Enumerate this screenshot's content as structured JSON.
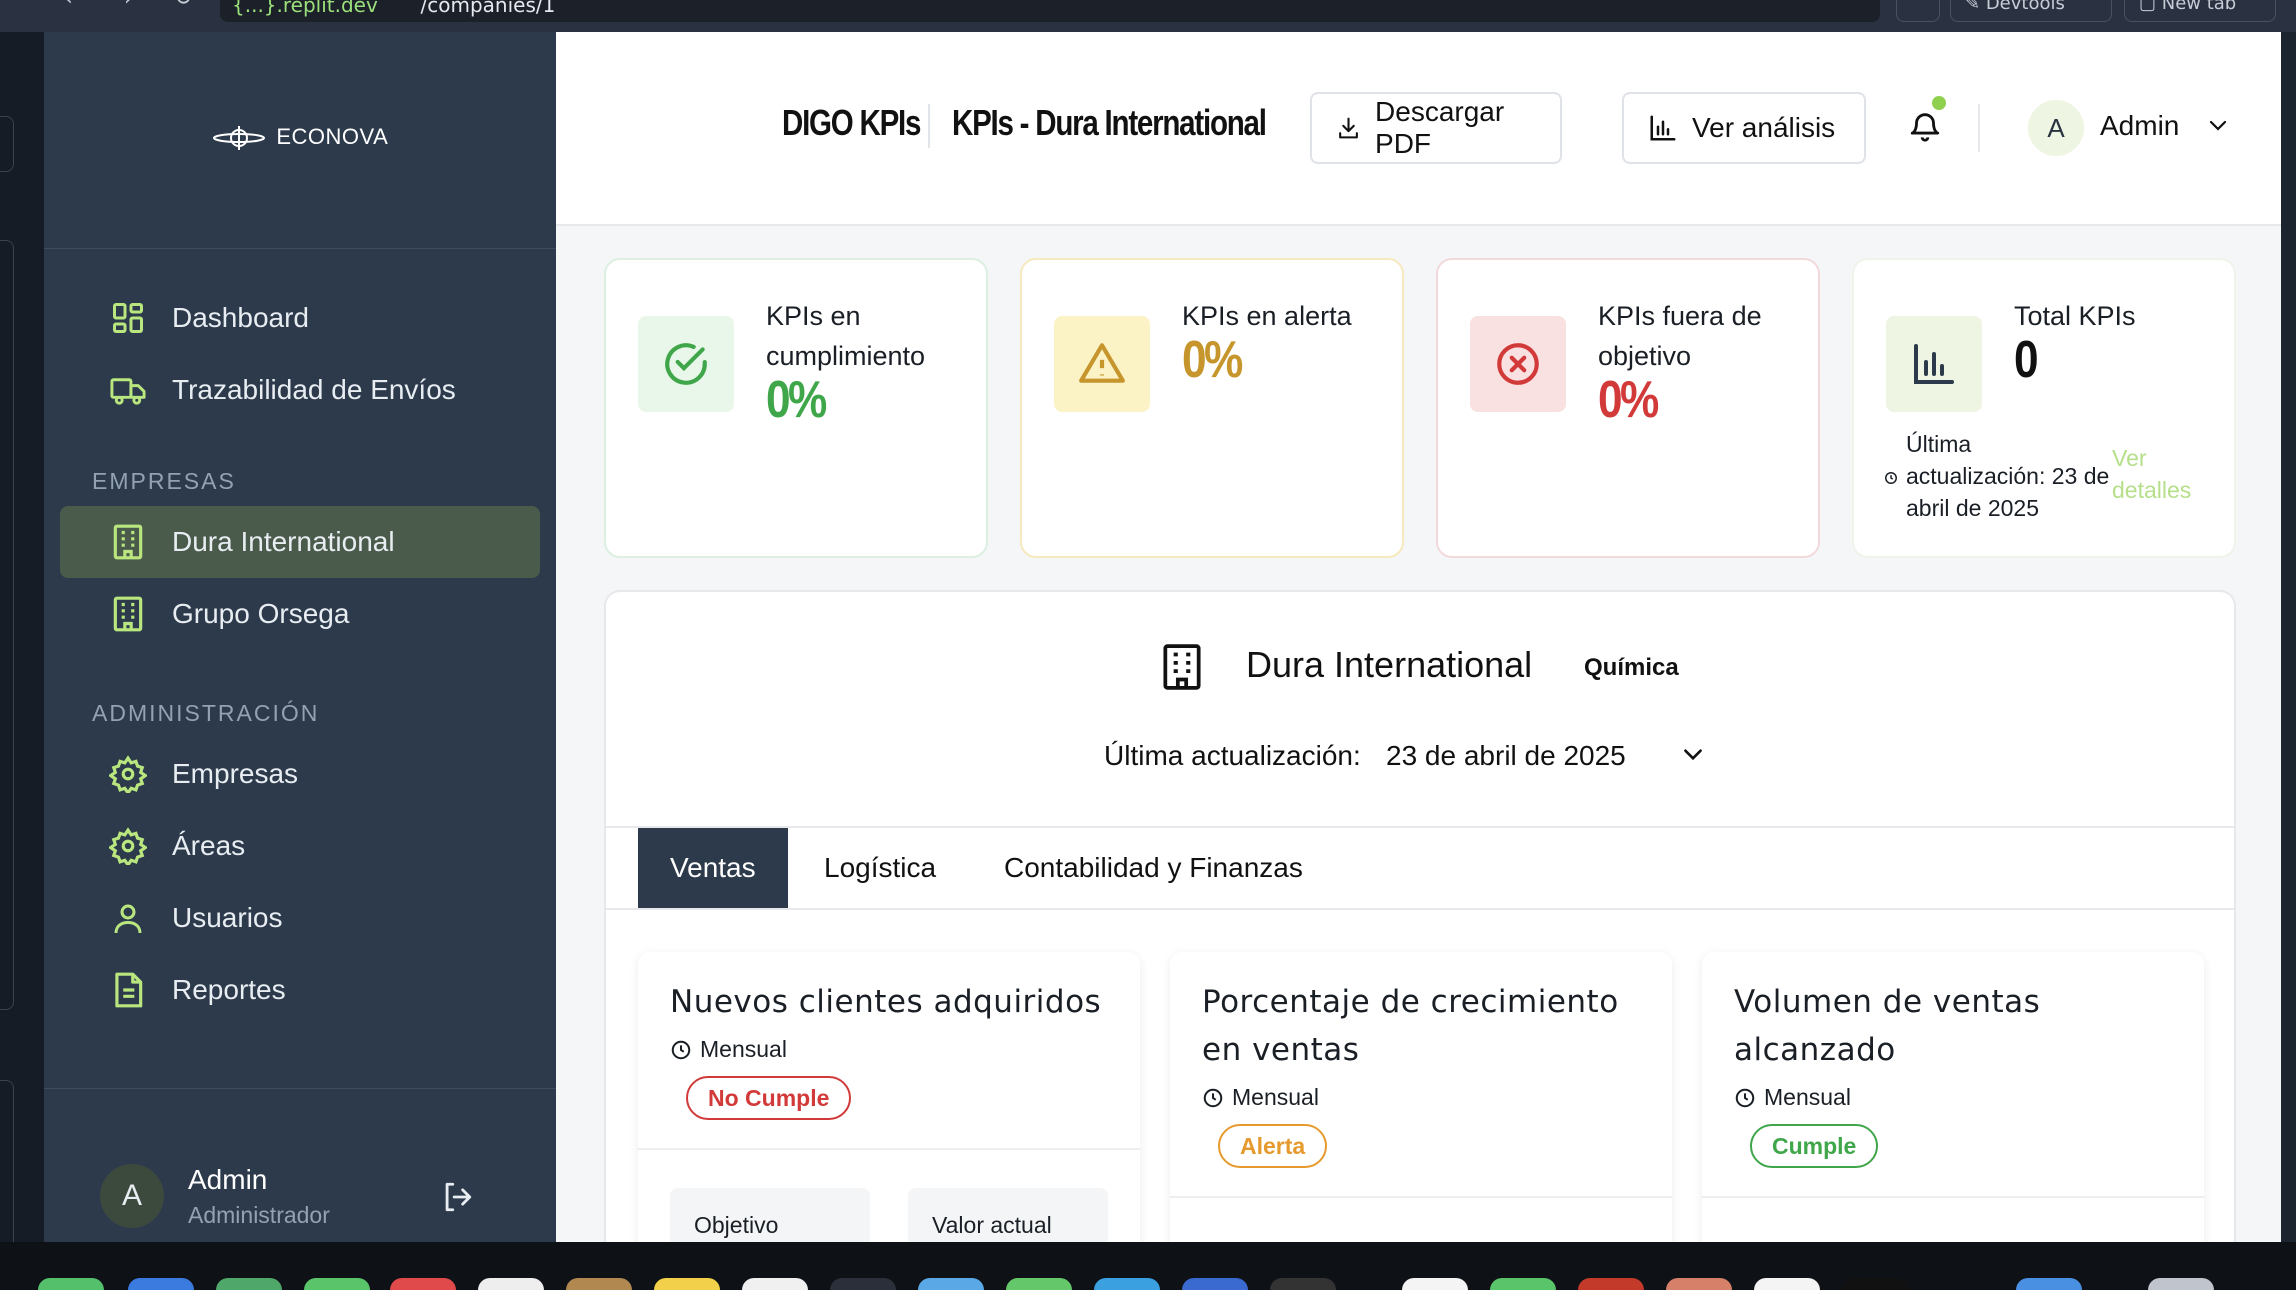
{
  "browser": {
    "url_host": "{...}.replit.dev",
    "url_path": "/companies/1",
    "devtools_label": "Devtools",
    "new_tab_label": "New tab"
  },
  "sidebar": {
    "logo_text": "ECONOVA",
    "main_items": [
      {
        "label": "Dashboard",
        "icon": "layout-grid-icon"
      },
      {
        "label": "Trazabilidad de Envíos",
        "icon": "truck-icon"
      }
    ],
    "companies_section": "EMPRESAS",
    "companies": [
      {
        "label": "Dura International",
        "icon": "building-icon",
        "active": true
      },
      {
        "label": "Grupo Orsega",
        "icon": "building-icon",
        "active": false
      }
    ],
    "admin_section": "ADMINISTRACIÓN",
    "admin_items": [
      {
        "label": "Empresas",
        "icon": "gear-icon"
      },
      {
        "label": "Áreas",
        "icon": "gear-icon"
      },
      {
        "label": "Usuarios",
        "icon": "user-icon"
      },
      {
        "label": "Reportes",
        "icon": "document-icon"
      }
    ],
    "user": {
      "initial": "A",
      "name": "Admin",
      "role": "Administrador"
    }
  },
  "header": {
    "brand": "DIGO KPIs",
    "title": "KPIs - Dura International",
    "download_label": "Descargar PDF",
    "analysis_label": "Ver análisis",
    "user_initial": "A",
    "user_name": "Admin"
  },
  "kpis": [
    {
      "label": "KPIs en cumplimiento",
      "value": "0%",
      "color": "#3fa64a",
      "bg": "#e9f7ea",
      "border": "#dcefe0",
      "icon": "check-circle-icon"
    },
    {
      "label": "KPIs en alerta",
      "value": "0%",
      "color": "#c6952b",
      "bg": "#fbf2c6",
      "border": "#f6e9bd",
      "icon": "alert-triangle-icon"
    },
    {
      "label": "KPIs fuera de objetivo",
      "value": "0%",
      "color": "#d23a3a",
      "bg": "#f9e1e1",
      "border": "#f4d9dc",
      "icon": "x-circle-icon"
    },
    {
      "label": "Total KPIs",
      "value": "0",
      "color": "#111111",
      "bg": "#eef5e2",
      "border": "#f0f3ea",
      "icon": "bar-chart-icon",
      "updated": "Última actualización: 23 de abril de 2025",
      "link": "Ver detalles"
    }
  ],
  "company": {
    "name": "Dura International",
    "industry": "Química",
    "updated_label": "Última actualización:",
    "updated_value": "23 de abril de 2025"
  },
  "tabs": [
    {
      "label": "Ventas",
      "active": true
    },
    {
      "label": "Logística",
      "active": false
    },
    {
      "label": "Contabilidad y Finanzas",
      "active": false
    }
  ],
  "kpi_cards": [
    {
      "title": "Nuevos clientes adquiridos",
      "frequency": "Mensual",
      "status": "No Cumple",
      "status_color": "#d23a3a"
    },
    {
      "title": "Porcentaje de crecimiento en ventas",
      "frequency": "Mensual",
      "status": "Alerta",
      "status_color": "#e69a2e"
    },
    {
      "title": "Volumen de ventas alcanzado",
      "frequency": "Mensual",
      "status": "Cumple",
      "status_color": "#3fa64a"
    }
  ],
  "card_boxes": {
    "objective_label": "Objetivo",
    "current_label": "Valor actual"
  }
}
